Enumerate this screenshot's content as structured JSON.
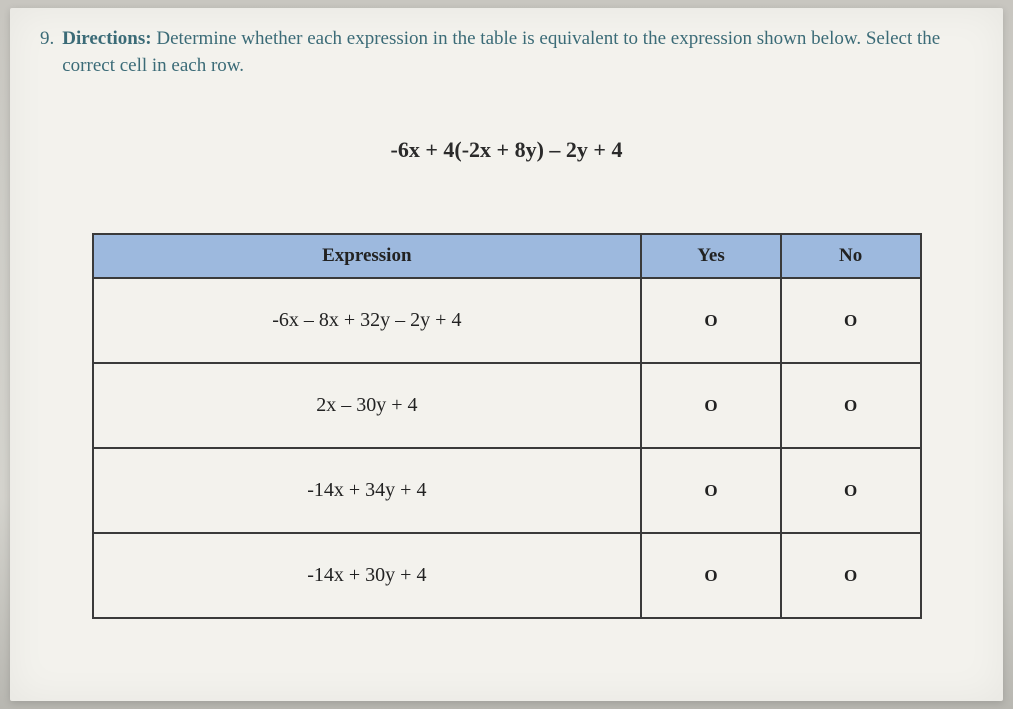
{
  "question": {
    "number": "9.",
    "directions_label": "Directions:",
    "directions_text": "Determine whether each expression in the table is equivalent to the expression shown below. Select the correct cell in each row."
  },
  "main_expression": "-6x + 4(-2x + 8y) – 2y + 4",
  "table": {
    "headers": {
      "expression": "Expression",
      "yes": "Yes",
      "no": "No"
    },
    "rows": [
      {
        "expr": "-6x – 8x + 32y – 2y + 4",
        "yes": "O",
        "no": "O"
      },
      {
        "expr": "2x – 30y + 4",
        "yes": "O",
        "no": "O"
      },
      {
        "expr": "-14x + 34y + 4",
        "yes": "O",
        "no": "O"
      },
      {
        "expr": "-14x + 30y + 4",
        "yes": "O",
        "no": "O"
      }
    ]
  }
}
